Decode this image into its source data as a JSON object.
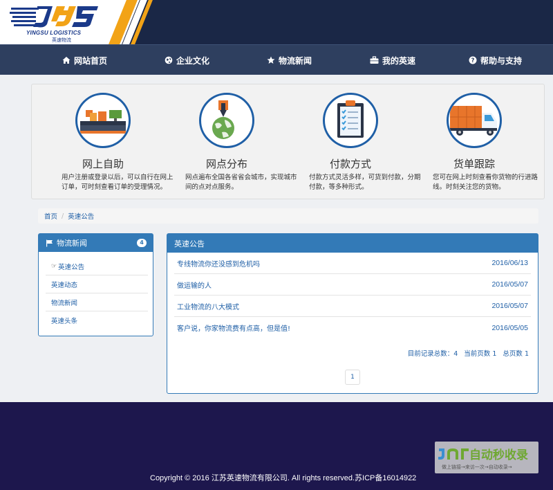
{
  "brand": {
    "name_en": "YINGSU LOGISTICS",
    "name_cn": "英速物流",
    "colors": {
      "navy": "#1a2746",
      "nav": "#2e3f5f",
      "orange": "#f2a317",
      "primary": "#337ab7",
      "footer": "#1d174d"
    }
  },
  "nav": [
    {
      "label": "网站首页",
      "icon": "home-icon"
    },
    {
      "label": "企业文化",
      "icon": "globe-icon"
    },
    {
      "label": "物流新闻",
      "icon": "star-icon"
    },
    {
      "label": "我的英速",
      "icon": "briefcase-icon"
    },
    {
      "label": "帮助与支持",
      "icon": "question-circle-icon"
    }
  ],
  "features": [
    {
      "title": "网上自助",
      "desc": "用户注册或登录以后，可以自行在网上订单，可时刻查看订单的受理情况。",
      "icon": "warehouse-icon"
    },
    {
      "title": "网点分布",
      "desc": "网点遍布全国各省省会城市，实现城市间的点对点服务。",
      "icon": "globe-pin-icon"
    },
    {
      "title": "付款方式",
      "desc": "付款方式灵活多样，可货到付款，分期付款，等多种形式。",
      "icon": "clipboard-icon"
    },
    {
      "title": "货单跟踪",
      "desc": "您可在网上时刻查看你货物的行进路线。时刻关注您的货物。",
      "icon": "truck-icon"
    }
  ],
  "breadcrumb": {
    "home": "首页",
    "separator": "/",
    "current": "英速公告"
  },
  "sidebar": {
    "title": "物流新闻",
    "badge": "4",
    "items": [
      {
        "label": "英速公告",
        "active": true
      },
      {
        "label": "英速动态"
      },
      {
        "label": "物流新闻"
      },
      {
        "label": "英速头条"
      }
    ]
  },
  "panel": {
    "title": "英速公告",
    "news": [
      {
        "title": "专线物流你还没感到危机吗",
        "date": "2016/06/13"
      },
      {
        "title": "做运输的人",
        "date": "2016/05/07"
      },
      {
        "title": "工业物流的八大模式",
        "date": "2016/05/07"
      },
      {
        "title": "客户说，你家物流费有点高，但是值!",
        "date": "2016/05/05"
      }
    ],
    "pager": {
      "total_label": "目前记录总数：",
      "total": "4",
      "current_label": "当前页数",
      "current": "1",
      "pages_label": "总页数",
      "pages": "1",
      "page_button": "1"
    }
  },
  "footer": {
    "copyright": "Copyright © 2016 江苏英速物流有限公司. All rights reserved.苏ICP备16014922"
  },
  "watermark": {
    "text": "自动秒收录",
    "sub": "做上链接→来访一次→自动收录→"
  }
}
